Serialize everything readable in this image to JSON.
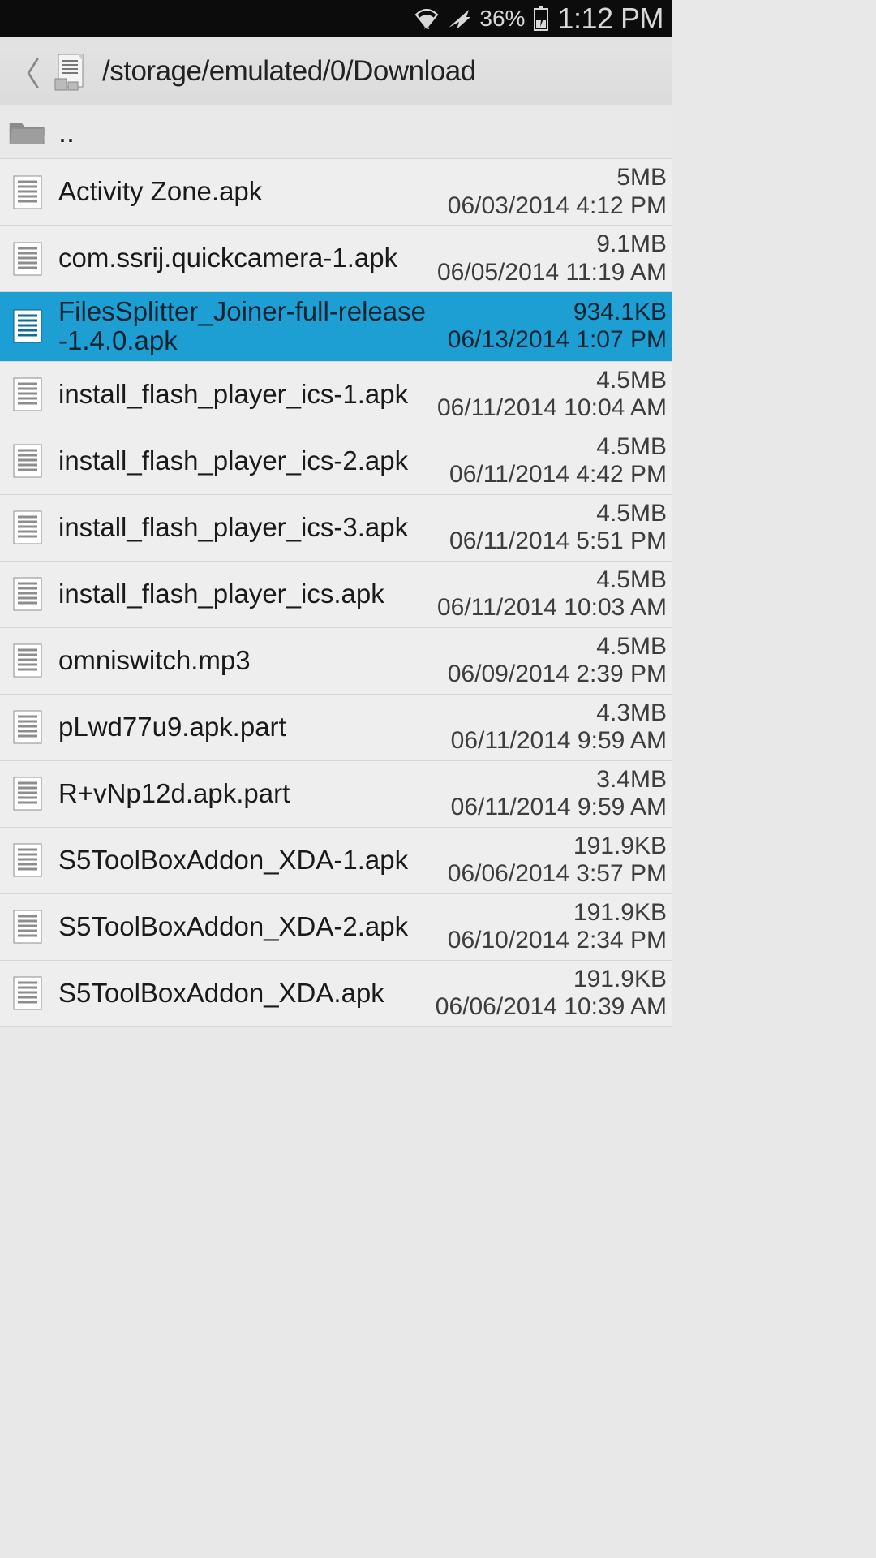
{
  "status": {
    "battery_pct": "36%",
    "time": "1:12 PM"
  },
  "header": {
    "path": "/storage/emulated/0/Download"
  },
  "parent_label": "..",
  "files": [
    {
      "name": "Activity Zone.apk",
      "size": "5MB",
      "date": "06/03/2014 4:12 PM",
      "selected": false
    },
    {
      "name": "com.ssrij.quickcamera-1.apk",
      "size": "9.1MB",
      "date": "06/05/2014 11:19 AM",
      "selected": false
    },
    {
      "name": "FilesSplitter_Joiner-full-release-1.4.0.apk",
      "size": "934.1KB",
      "date": "06/13/2014 1:07 PM",
      "selected": true
    },
    {
      "name": "install_flash_player_ics-1.apk",
      "size": "4.5MB",
      "date": "06/11/2014 10:04 AM",
      "selected": false
    },
    {
      "name": "install_flash_player_ics-2.apk",
      "size": "4.5MB",
      "date": "06/11/2014 4:42 PM",
      "selected": false
    },
    {
      "name": "install_flash_player_ics-3.apk",
      "size": "4.5MB",
      "date": "06/11/2014 5:51 PM",
      "selected": false
    },
    {
      "name": "install_flash_player_ics.apk",
      "size": "4.5MB",
      "date": "06/11/2014 10:03 AM",
      "selected": false
    },
    {
      "name": "omniswitch.mp3",
      "size": "4.5MB",
      "date": "06/09/2014 2:39 PM",
      "selected": false
    },
    {
      "name": "pLwd77u9.apk.part",
      "size": "4.3MB",
      "date": "06/11/2014 9:59 AM",
      "selected": false
    },
    {
      "name": "R+vNp12d.apk.part",
      "size": "3.4MB",
      "date": "06/11/2014 9:59 AM",
      "selected": false
    },
    {
      "name": "S5ToolBoxAddon_XDA-1.apk",
      "size": "191.9KB",
      "date": "06/06/2014 3:57 PM",
      "selected": false
    },
    {
      "name": "S5ToolBoxAddon_XDA-2.apk",
      "size": "191.9KB",
      "date": "06/10/2014 2:34 PM",
      "selected": false
    },
    {
      "name": "S5ToolBoxAddon_XDA.apk",
      "size": "191.9KB",
      "date": "06/06/2014 10:39 AM",
      "selected": false
    }
  ]
}
